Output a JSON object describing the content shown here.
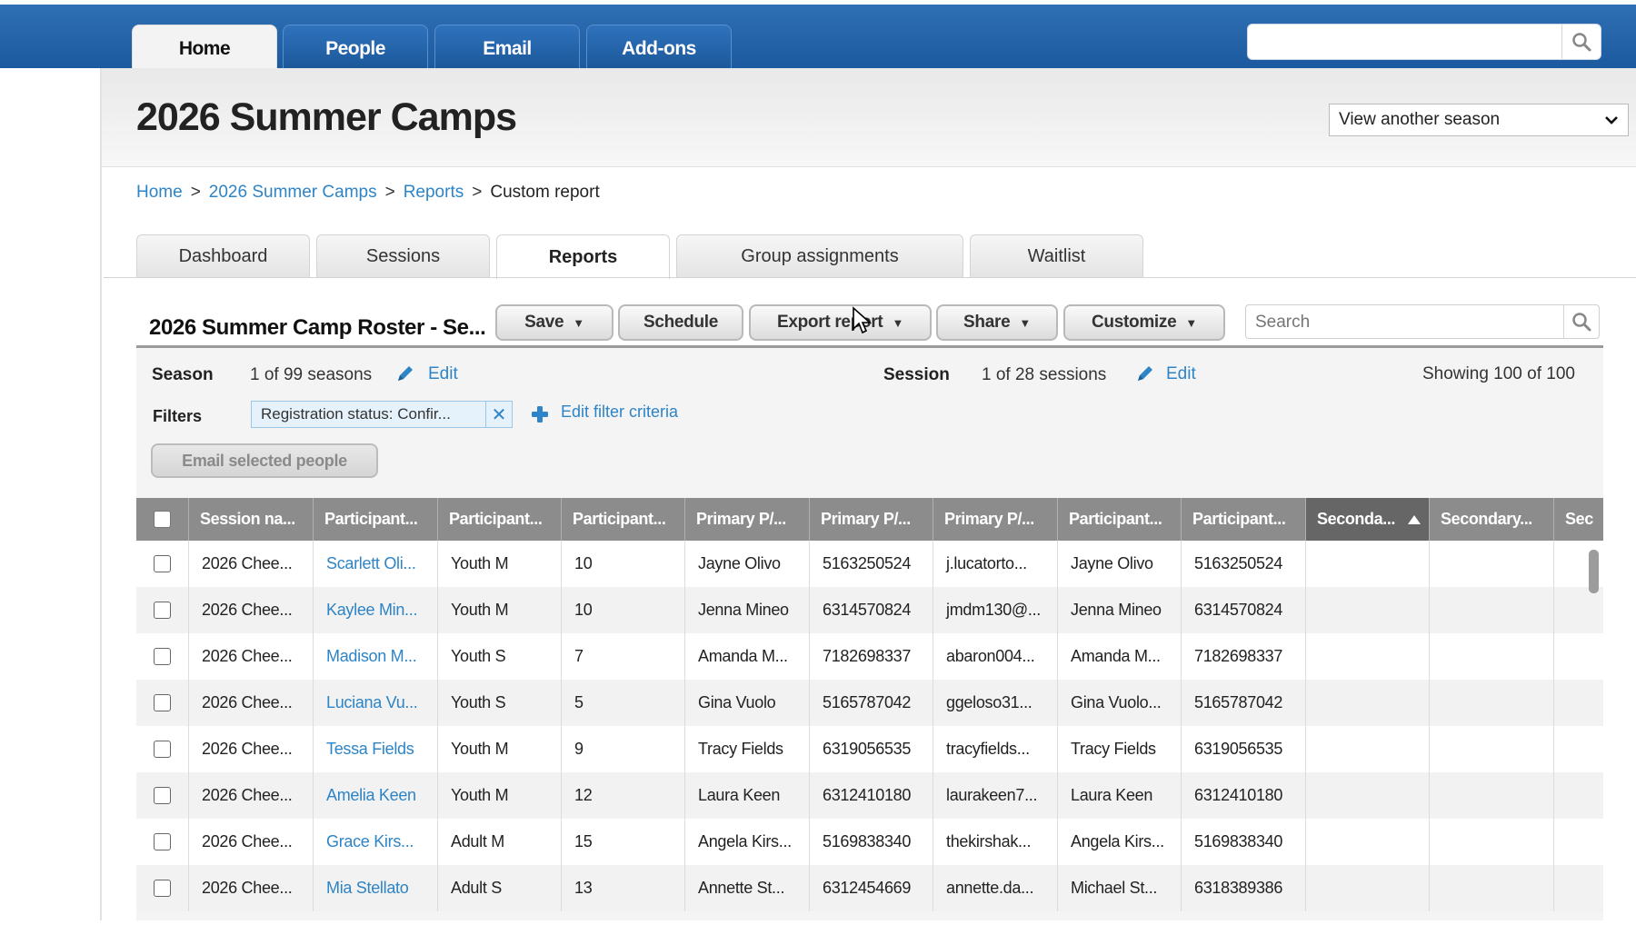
{
  "nav": {
    "tabs": [
      {
        "label": "Home",
        "active": true
      },
      {
        "label": "People",
        "active": false
      },
      {
        "label": "Email",
        "active": false
      },
      {
        "label": "Add-ons",
        "active": false
      }
    ],
    "search_value": "",
    "search_icon": "search-icon"
  },
  "header": {
    "title": "2026 Summer Camps",
    "season_select": "View another season"
  },
  "breadcrumb": {
    "items": [
      "Home",
      "2026 Summer Camps",
      "Reports"
    ],
    "current": "Custom report",
    "separator": ">"
  },
  "sub_tabs": [
    {
      "label": "Dashboard",
      "active": false
    },
    {
      "label": "Sessions",
      "active": false
    },
    {
      "label": "Reports",
      "active": true
    },
    {
      "label": "Group assignments",
      "active": false
    },
    {
      "label": "Waitlist",
      "active": false
    }
  ],
  "report": {
    "title": "2026 Summer Camp Roster - Se...",
    "buttons": {
      "save": "Save",
      "schedule": "Schedule",
      "export": "Export report",
      "share": "Share",
      "customize": "Customize"
    },
    "search_placeholder": "Search",
    "season_label": "Season",
    "season_value": "1 of 99 seasons",
    "session_label": "Session",
    "session_value": "1 of 28 sessions",
    "edit_label": "Edit",
    "showing": "Showing 100 of 100",
    "filters_label": "Filters",
    "filter_chip": "Registration status: Confir...",
    "edit_filter": "Edit filter criteria",
    "email_selected": "Email selected people"
  },
  "table": {
    "columns": [
      "Session na...",
      "Participant...",
      "Participant...",
      "Participant...",
      "Primary P/...",
      "Primary P/...",
      "Primary P/...",
      "Participant...",
      "Participant...",
      "Seconda...",
      "Secondary...",
      "Sec"
    ],
    "rows": [
      [
        "2026 Chee...",
        "Scarlett Oli...",
        "Youth M",
        "10",
        "Jayne Olivo",
        "5163250524",
        "j.lucatorto...",
        "Jayne Olivo",
        "5163250524",
        "",
        "",
        ""
      ],
      [
        "2026 Chee...",
        "Kaylee Min...",
        "Youth M",
        "10",
        "Jenna Mineo",
        "6314570824",
        "jmdm130@...",
        "Jenna Mineo",
        "6314570824",
        "",
        "",
        ""
      ],
      [
        "2026 Chee...",
        "Madison M...",
        "Youth S",
        "7",
        "Amanda M...",
        "7182698337",
        "abaron004...",
        "Amanda M...",
        "7182698337",
        "",
        "",
        ""
      ],
      [
        "2026 Chee...",
        "Luciana Vu...",
        "Youth S",
        "5",
        "Gina Vuolo",
        "5165787042",
        "ggeloso31...",
        "Gina Vuolo...",
        "5165787042",
        "",
        "",
        ""
      ],
      [
        "2026 Chee...",
        "Tessa Fields",
        "Youth M",
        "9",
        "Tracy Fields",
        "6319056535",
        "tracyfields...",
        "Tracy Fields",
        "6319056535",
        "",
        "",
        ""
      ],
      [
        "2026 Chee...",
        "Amelia Keen",
        "Youth M",
        "12",
        "Laura Keen",
        "6312410180",
        "laurakeen7...",
        "Laura Keen",
        "6312410180",
        "",
        "",
        ""
      ],
      [
        "2026 Chee...",
        "Grace Kirs...",
        "Adult M",
        "15",
        "Angela Kirs...",
        "5169838340",
        "thekirshak...",
        "Angela Kirs...",
        "5169838340",
        "",
        "",
        ""
      ],
      [
        "2026 Chee...",
        "Mia Stellato",
        "Adult S",
        "13",
        "Annette St...",
        "6312454669",
        "annette.da...",
        "Michael St...",
        "6318389386",
        "",
        "",
        ""
      ]
    ]
  },
  "colors": {
    "nav_blue": "#1c5a9f",
    "link": "#2d84c6",
    "header_gray": "#8c8c8c"
  }
}
